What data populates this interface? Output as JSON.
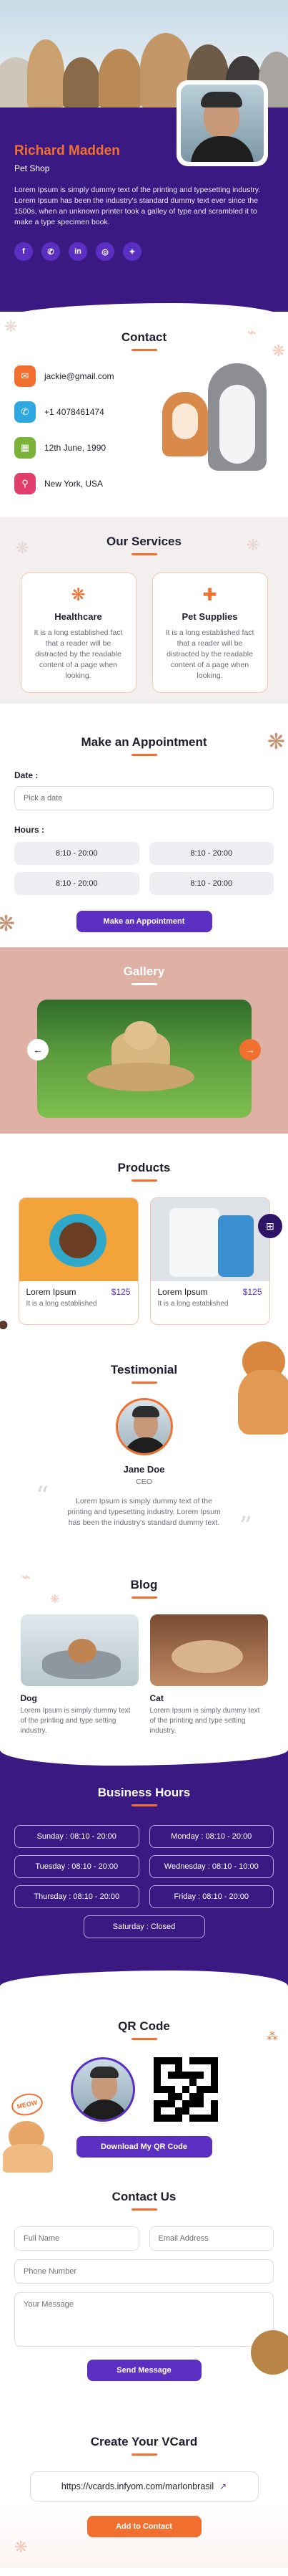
{
  "profile": {
    "name": "Richard Madden",
    "role": "Pet Shop",
    "description": "Lorem Ipsum is simply dummy text of the printing and typesetting industry. Lorem Ipsum has been the industry's standard dummy text ever since the 1500s, when an unknown printer took a galley of type and scrambled it to make a type specimen book.",
    "socials": [
      {
        "icon": "facebook-icon",
        "glyph": "f"
      },
      {
        "icon": "whatsapp-icon",
        "glyph": "✆"
      },
      {
        "icon": "linkedin-icon",
        "glyph": "in"
      },
      {
        "icon": "instagram-icon",
        "glyph": "◎"
      },
      {
        "icon": "twitter-icon",
        "glyph": "✦"
      }
    ]
  },
  "contact": {
    "title": "Contact",
    "items": [
      {
        "icon": "email-icon",
        "glyph": "✉",
        "color": "#f2702f",
        "text": "jackie@gmail.com"
      },
      {
        "icon": "phone-icon",
        "glyph": "✆",
        "color": "#2fa8e0",
        "text": "+1 4078461474"
      },
      {
        "icon": "calendar-icon",
        "glyph": "▦",
        "color": "#7bb33a",
        "text": "12th June, 1990"
      },
      {
        "icon": "location-icon",
        "glyph": "⚲",
        "color": "#e03e6b",
        "text": "New York, USA"
      }
    ]
  },
  "services": {
    "title": "Our Services",
    "cards": [
      {
        "icon": "paw-icon",
        "glyph": "❋",
        "title": "Healthcare",
        "desc": "It is a long established fact that a reader will be distracted by the readable content of a page when looking."
      },
      {
        "icon": "bone-icon",
        "glyph": "✚",
        "title": "Pet Supplies",
        "desc": "It is a long established fact that a reader will be distracted by the readable content of a page when looking."
      }
    ]
  },
  "appointment": {
    "title": "Make an Appointment",
    "date_label": "Date :",
    "date_placeholder": "Pick a date",
    "hours_label": "Hours :",
    "slots": [
      "8:10 - 20:00",
      "8:10 - 20:00",
      "8:10 - 20:00",
      "8:10 - 20:00"
    ],
    "button": "Make an Appointment"
  },
  "gallery": {
    "title": "Gallery",
    "prev": "←",
    "next": "→"
  },
  "products": {
    "title": "Products",
    "items": [
      {
        "name": "Lorem Ipsum",
        "price": "$125",
        "desc": "It is a long established"
      },
      {
        "name": "Lorem Ipsum",
        "price": "$125",
        "desc": "It is a long established"
      }
    ]
  },
  "testimonial": {
    "title": "Testimonial",
    "name": "Jane Doe",
    "role": "CEO",
    "text": "Lorem Ipsum is simply dummy text of the printing and typesetting industry. Lorem Ipsum has been the industry's standard dummy text."
  },
  "blog": {
    "title": "Blog",
    "posts": [
      {
        "title": "Dog",
        "desc": "Lorem Ipsum is simply dummy text of the printing and type setting industry."
      },
      {
        "title": "Cat",
        "desc": "Lorem Ipsum is simply dummy text of the printing and type setting industry."
      }
    ]
  },
  "business_hours": {
    "title": "Business Hours",
    "days": [
      "Sunday : 08:10 - 20:00",
      "Monday : 08:10 - 20:00",
      "Tuesday : 08:10 - 20:00",
      "Wednesday : 08:10 - 10:00",
      "Thursday : 08:10 - 20:00",
      "Friday : 08:10 - 20:00"
    ],
    "saturday": "Saturday : Closed"
  },
  "qr": {
    "title": "QR Code",
    "button": "Download My QR Code",
    "sticker": "MEOW"
  },
  "contact_form": {
    "title": "Contact Us",
    "full_name": "Full Name",
    "email": "Email Address",
    "phone": "Phone Number",
    "message": "Your Message",
    "button": "Send Message"
  },
  "vcard": {
    "title": "Create Your VCard",
    "url": "https://vcards.infyom.com/marlonbrasil",
    "button": "Add to Contact"
  },
  "colors": {
    "primary": "#5b2fc1",
    "accent": "#f2702f",
    "dark_purple": "#3a1a82",
    "gallery_bg": "#dfb1a4"
  }
}
